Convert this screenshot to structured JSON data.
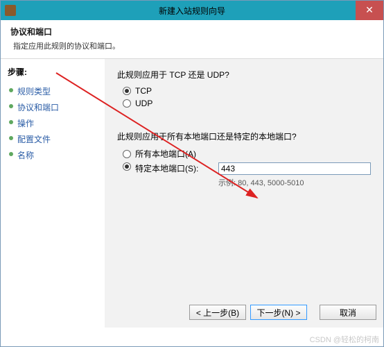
{
  "title": "新建入站规则向导",
  "header": {
    "title": "协议和端口",
    "subtitle": "指定应用此规则的协议和端口。"
  },
  "sidebar": {
    "steps_label": "步骤:",
    "items": [
      "规则类型",
      "协议和端口",
      "操作",
      "配置文件",
      "名称"
    ]
  },
  "content": {
    "q1": "此规则应用于 TCP 还是 UDP?",
    "tcp_label": "TCP",
    "udp_label": "UDP",
    "q2": "此规则应用于所有本地端口还是特定的本地端口?",
    "all_ports_label": "所有本地端口(A)",
    "specific_ports_label": "特定本地端口(S):",
    "port_value": "443",
    "port_hint": "示例: 80, 443, 5000-5010"
  },
  "footer": {
    "back": "< 上一步(B)",
    "next": "下一步(N) >",
    "cancel": "取消"
  },
  "watermark": "CSDN @轻松的柯南",
  "close_glyph": "✕"
}
